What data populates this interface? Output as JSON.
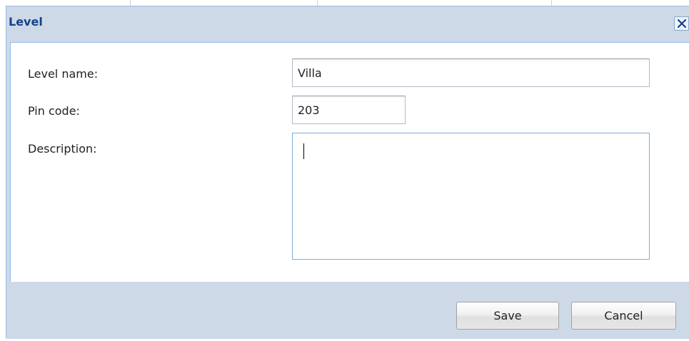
{
  "dialog": {
    "title": "Level",
    "close_label": "×"
  },
  "form": {
    "level_name_label": "Level name:",
    "level_name_value": "Villa",
    "pin_code_label": "Pin code:",
    "pin_code_value": "203",
    "description_label": "Description:",
    "description_value": ""
  },
  "footer": {
    "save_label": "Save",
    "cancel_label": "Cancel"
  },
  "colors": {
    "title_text": "#15428b",
    "frame_background": "#cdd9e7",
    "frame_border": "#99bbe8",
    "field_focus_border": "#7eadd9"
  },
  "icons": {
    "close": "close-icon"
  }
}
